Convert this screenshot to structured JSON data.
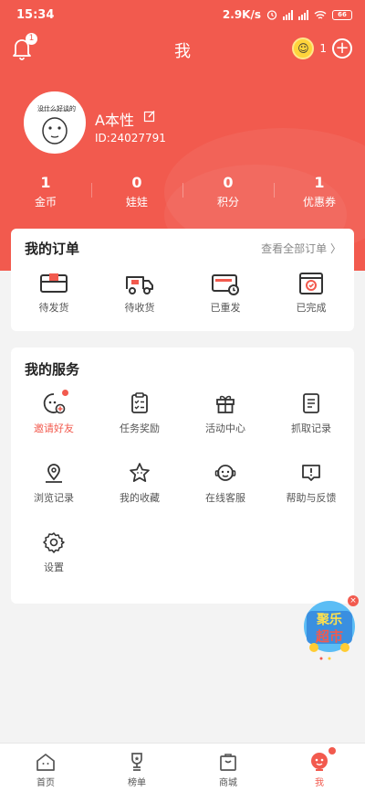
{
  "status_bar": {
    "time": "15:34",
    "net_speed": "2.9K/s",
    "battery": "66"
  },
  "header": {
    "title": "我",
    "bell_badge": "1",
    "coin_count": "1"
  },
  "profile": {
    "username": "A本性",
    "user_id": "ID:24027791",
    "avatar_caption": "没什么好谈的"
  },
  "stats": [
    {
      "value": "1",
      "label": "金币"
    },
    {
      "value": "0",
      "label": "娃娃"
    },
    {
      "value": "0",
      "label": "积分"
    },
    {
      "value": "1",
      "label": "优惠券"
    }
  ],
  "orders": {
    "title": "我的订单",
    "view_all": "查看全部订单 〉",
    "items": [
      {
        "label": "待发货",
        "icon": "box-icon"
      },
      {
        "label": "待收货",
        "icon": "truck-icon"
      },
      {
        "label": "已重发",
        "icon": "resend-icon"
      },
      {
        "label": "已完成",
        "icon": "completed-icon"
      }
    ]
  },
  "services": {
    "title": "我的服务",
    "items": [
      {
        "label": "邀请好友",
        "icon": "invite-icon"
      },
      {
        "label": "任务奖励",
        "icon": "task-icon"
      },
      {
        "label": "活动中心",
        "icon": "gift-icon"
      },
      {
        "label": "抓取记录",
        "icon": "record-icon"
      },
      {
        "label": "浏览记录",
        "icon": "location-icon"
      },
      {
        "label": "我的收藏",
        "icon": "star-icon"
      },
      {
        "label": "在线客服",
        "icon": "service-icon"
      },
      {
        "label": "帮助与反馈",
        "icon": "help-icon"
      },
      {
        "label": "设置",
        "icon": "settings-icon"
      }
    ]
  },
  "floating_banner": {
    "text_line1": "聚乐",
    "text_line2": "超市"
  },
  "tabbar": [
    {
      "label": "首页",
      "icon": "home-icon"
    },
    {
      "label": "榜单",
      "icon": "trophy-icon"
    },
    {
      "label": "商城",
      "icon": "shop-icon"
    },
    {
      "label": "我",
      "icon": "profile-icon"
    }
  ],
  "colors": {
    "accent": "#f25a4e",
    "background": "#f3f3f3"
  }
}
